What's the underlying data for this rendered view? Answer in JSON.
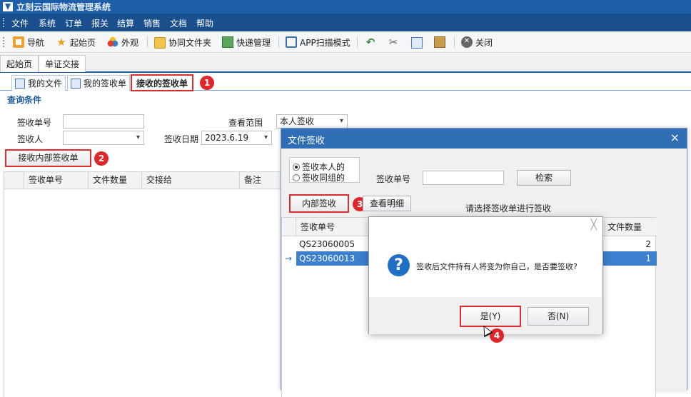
{
  "window": {
    "title": "立刻云国际物流管理系统"
  },
  "menu": [
    "文件",
    "系统",
    "订单",
    "报关",
    "结算",
    "销售",
    "文档",
    "帮助"
  ],
  "toolbar": {
    "nav": "导航",
    "start": "起始页",
    "look": "外观",
    "folder": "协同文件夹",
    "express": "快递管理",
    "scan": "APP扫描模式",
    "close": "关闭"
  },
  "main_tabs": [
    "起始页",
    "单证交接"
  ],
  "sub_tabs": [
    "我的文件",
    "我的签收单",
    "接收的签收单"
  ],
  "badges": [
    "1",
    "2",
    "3",
    "4"
  ],
  "query": {
    "title": "查询条件",
    "receipt_no_label": "签收单号",
    "receipt_no_value": "",
    "signer_label": "签收人",
    "signer_value": "",
    "scope_label": "查看范围",
    "scope_value": "本人签收",
    "date_label": "签收日期",
    "date_value": "2023.6.19",
    "receive_button": "接收内部签收单"
  },
  "grid": {
    "columns": [
      "签收单号",
      "文件数量",
      "交接给",
      "备注"
    ]
  },
  "dialog": {
    "title": "文件签收",
    "close": "×",
    "radio_self": "签收本人的",
    "radio_group": "签收同组的",
    "receipt_no_label": "签收单号",
    "receipt_no_value": "",
    "search_button": "检索",
    "internal_sign_button": "内部签收",
    "view_detail_button": "查看明细",
    "hint": "请选择签收单进行签收",
    "columns": [
      "签收单号",
      "文件数量"
    ],
    "rows": [
      {
        "no": "QS23060005",
        "count": "2",
        "selected": false
      },
      {
        "no": "QS23060013",
        "count": "1",
        "selected": true
      }
    ],
    "row_pointer": "→"
  },
  "confirm": {
    "close": "╳",
    "icon": "?",
    "message": "签收后文件持有人将变为你自己，是否要签收?",
    "yes": "是(Y)",
    "no": "否(N)"
  }
}
